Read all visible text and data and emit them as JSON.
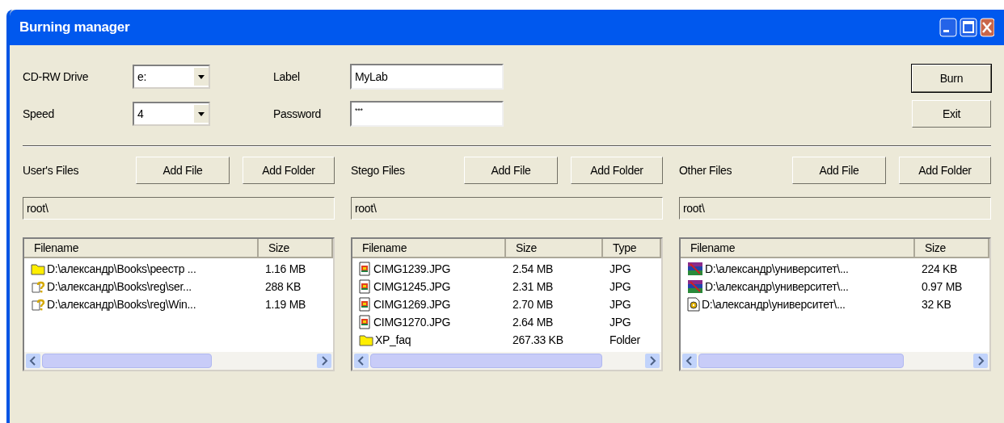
{
  "window": {
    "title": "Burning manager"
  },
  "settings": [
    {
      "label": "CD-RW Drive",
      "value": "e:"
    },
    {
      "label": "Speed",
      "value": "4"
    }
  ],
  "fields": [
    {
      "label": "Label",
      "value": "MyLab"
    },
    {
      "label": "Password",
      "value": "***"
    }
  ],
  "actions": [
    "Burn",
    "Exit"
  ],
  "panels": [
    {
      "title": "User's Files",
      "buttons": [
        "Add File",
        "Add Folder"
      ],
      "path": "root\\",
      "columns": [
        "Filename",
        "Size"
      ],
      "rows": [
        {
          "kind": "folder",
          "cells": [
            "D:\\александр\\Books\\реестр ...",
            "1.16 MB"
          ]
        },
        {
          "kind": "unknown",
          "cells": [
            "D:\\александр\\Books\\reg\\ser...",
            "288 KB"
          ]
        },
        {
          "kind": "unknown",
          "cells": [
            "D:\\александр\\Books\\reg\\Win...",
            "1.19 MB"
          ]
        }
      ]
    },
    {
      "title": "Stego Files",
      "buttons": [
        "Add File",
        "Add Folder"
      ],
      "path": "root\\",
      "columns": [
        "Filename",
        "Size",
        "Type"
      ],
      "rows": [
        {
          "kind": "image",
          "cells": [
            "CIMG1239.JPG",
            "2.54 MB",
            "JPG"
          ]
        },
        {
          "kind": "image",
          "cells": [
            "CIMG1245.JPG",
            "2.31 MB",
            "JPG"
          ]
        },
        {
          "kind": "image",
          "cells": [
            "CIMG1269.JPG",
            "2.70 MB",
            "JPG"
          ]
        },
        {
          "kind": "image",
          "cells": [
            "CIMG1270.JPG",
            "2.64 MB",
            "JPG"
          ]
        },
        {
          "kind": "folder",
          "cells": [
            "XP_faq",
            "267.33 KB",
            "Folder"
          ]
        }
      ]
    },
    {
      "title": "Other Files",
      "buttons": [
        "Add File",
        "Add Folder"
      ],
      "path": "root\\",
      "columns": [
        "Filename",
        "Size"
      ],
      "rows": [
        {
          "kind": "archive",
          "cells": [
            "D:\\александр\\университет\\...",
            "224 KB"
          ]
        },
        {
          "kind": "archive",
          "cells": [
            "D:\\александр\\университет\\...",
            "0.97 MB"
          ]
        },
        {
          "kind": "disc",
          "cells": [
            "D:\\александр\\университет\\...",
            "32 KB"
          ]
        }
      ]
    }
  ]
}
